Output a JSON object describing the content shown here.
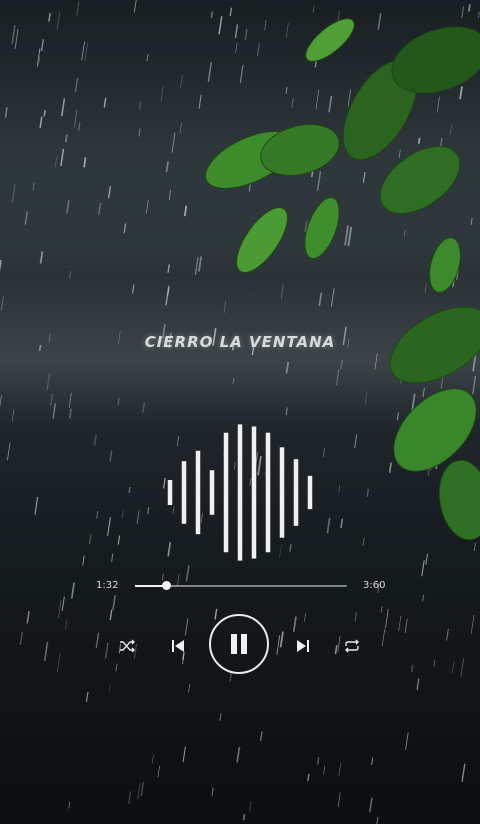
{
  "song": {
    "title": "CIERRO LA VENTANA"
  },
  "player": {
    "current_time": "1:32",
    "total_time": "3:60",
    "progress": 0.15,
    "state": "playing"
  },
  "waveform": {
    "bar_levels": [
      0.18,
      0.45,
      0.6,
      0.32,
      0.86,
      0.98,
      0.95,
      0.86,
      0.65,
      0.48,
      0.24
    ]
  },
  "controls": {
    "shuffle_icon": "shuffle-icon",
    "previous_icon": "skip-previous-icon",
    "play_pause_icon": "pause-icon",
    "next_icon": "skip-next-icon",
    "repeat_icon": "repeat-icon"
  },
  "colors": {
    "foreground": "#f0f0f0",
    "leaf": "#3d8a2c"
  }
}
